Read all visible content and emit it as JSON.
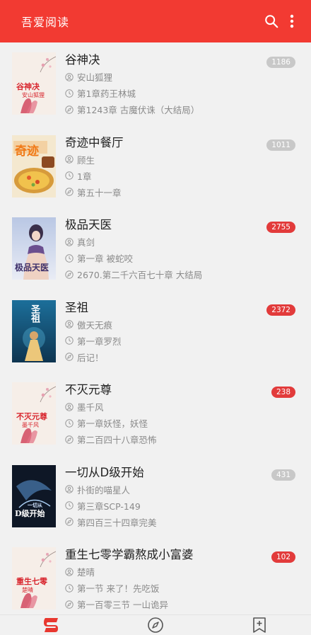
{
  "app": {
    "title": "吾爱阅读"
  },
  "books": [
    {
      "title": "谷神决",
      "author": "安山狐狸",
      "latest_read": "第1章药王林城",
      "latest_chapter": "第1243章 古魔伏诛（大结局）",
      "count": "1186",
      "badge_color": "gray",
      "cover": {
        "text1": "谷神决",
        "text2": "安山狐狸",
        "style": "floral"
      }
    },
    {
      "title": "奇迹中餐厅",
      "author": "顾生",
      "latest_read": "1章",
      "latest_chapter": "第五十一章",
      "count": "1011",
      "badge_color": "gray",
      "cover": {
        "text1": "奇迹",
        "text2": "",
        "style": "food"
      }
    },
    {
      "title": "极品天医",
      "author": "真剑",
      "latest_read": "第一章 被蛇咬",
      "latest_chapter": "2670.第二千六百七十章 大结局",
      "count": "2755",
      "badge_color": "red",
      "cover": {
        "text1": "极品天医",
        "text2": "",
        "style": "portrait"
      }
    },
    {
      "title": "圣祖",
      "author": "傲天无痕",
      "latest_read": "第一章罗烈",
      "latest_chapter": "后记！",
      "count": "2372",
      "badge_color": "red",
      "cover": {
        "text1": "圣祖",
        "text2": "",
        "style": "blue"
      }
    },
    {
      "title": "不灭元尊",
      "author": "墨千风",
      "latest_read": "第一章妖怪，妖怪",
      "latest_chapter": "第二百四十八章恐怖",
      "count": "238",
      "badge_color": "red",
      "cover": {
        "text1": "不灭元尊",
        "text2": "墨千风",
        "style": "floral"
      }
    },
    {
      "title": "一切从D级开始",
      "author": "扑街的喵星人",
      "latest_read": "第三章SCP-149",
      "latest_chapter": "第四百三十四章完美",
      "count": "431",
      "badge_color": "gray",
      "cover": {
        "text1": "D级开始",
        "text2": "一切从",
        "style": "dark"
      }
    },
    {
      "title": "重生七零学霸熬成小富婆",
      "author": "楚晴",
      "latest_read": "第一节 来了！先吃饭",
      "latest_chapter": "第一百零三节 一山诡异",
      "count": "102",
      "badge_color": "red",
      "cover": {
        "text1": "重生七零",
        "text2": "楚晴",
        "style": "floral"
      }
    }
  ],
  "colors": {
    "accent": "#f23a32",
    "badge_red": "#e23b3b",
    "badge_gray": "#c8c8c8"
  },
  "icons": {
    "appbar": [
      "search-icon",
      "more-vert-icon"
    ],
    "rows": [
      "author-icon",
      "clock-icon",
      "compass-icon"
    ],
    "bottom_tabs": [
      "bookshelf-icon",
      "discover-icon",
      "bookmark-add-icon"
    ]
  }
}
